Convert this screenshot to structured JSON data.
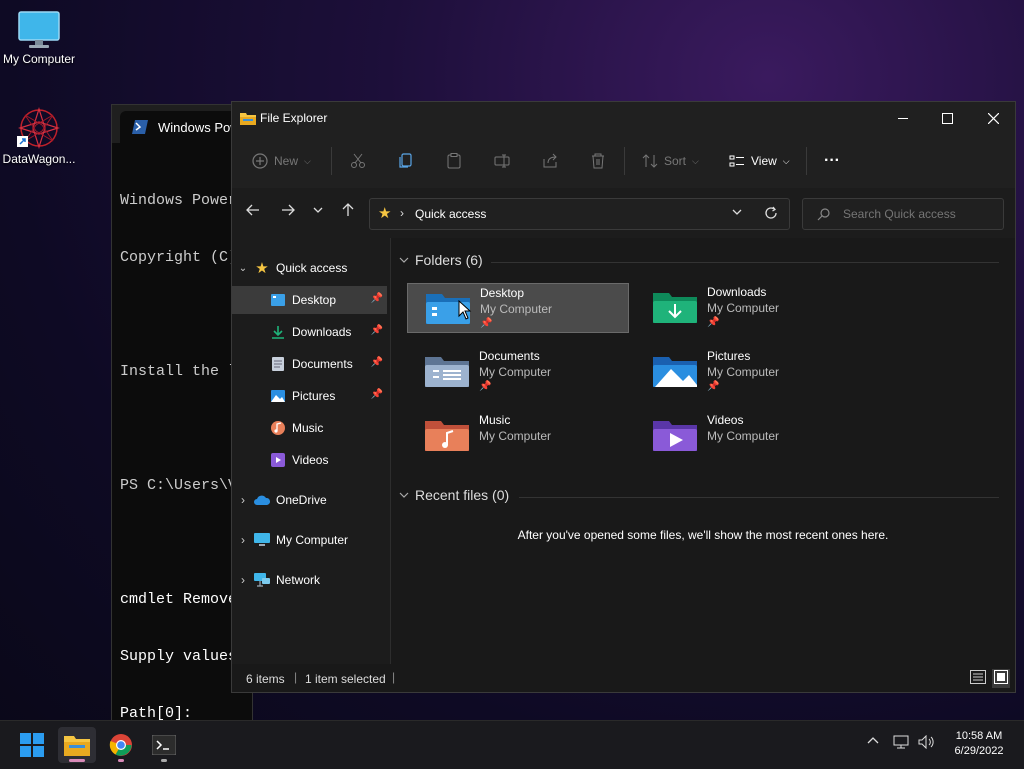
{
  "desktop": {
    "icons": [
      {
        "label": "My Computer"
      },
      {
        "label": "DataWagon..."
      }
    ]
  },
  "powershell": {
    "tab_title": "Windows Powe",
    "lines": [
      "Windows Power",
      "Copyright (C)",
      "",
      "Install the l",
      "",
      "PS C:\\Users\\V",
      "",
      "cmdlet Remove",
      "Supply values",
      "Path[0]:"
    ]
  },
  "explorer": {
    "title": "File Explorer",
    "toolbar": {
      "new_label": "New",
      "sort_label": "Sort",
      "view_label": "View",
      "more_label": "···"
    },
    "address": {
      "location": "Quick access"
    },
    "search": {
      "placeholder": "Search Quick access"
    },
    "sidebar": {
      "quick_access": "Quick access",
      "pinned": [
        {
          "label": "Desktop"
        },
        {
          "label": "Downloads"
        },
        {
          "label": "Documents"
        },
        {
          "label": "Pictures"
        },
        {
          "label": "Music"
        },
        {
          "label": "Videos"
        }
      ],
      "onedrive": "OneDrive",
      "my_computer": "My Computer",
      "network": "Network"
    },
    "main": {
      "folders_header": "Folders (6)",
      "folders": [
        {
          "name": "Desktop",
          "location": "My Computer",
          "pinned": true,
          "selected": true,
          "color": "#3aa0e8"
        },
        {
          "name": "Downloads",
          "location": "My Computer",
          "pinned": true,
          "selected": false,
          "color": "#1fb37a"
        },
        {
          "name": "Documents",
          "location": "My Computer",
          "pinned": true,
          "selected": false,
          "color": "#8aa4c8"
        },
        {
          "name": "Pictures",
          "location": "My Computer",
          "pinned": true,
          "selected": false,
          "color": "#2a8ee0"
        },
        {
          "name": "Music",
          "location": "My Computer",
          "pinned": false,
          "selected": false,
          "color": "#e8805a"
        },
        {
          "name": "Videos",
          "location": "My Computer",
          "pinned": false,
          "selected": false,
          "color": "#8a5ad8"
        }
      ],
      "recent_header": "Recent files (0)",
      "recent_empty": "After you've opened some files, we'll show the most recent ones here."
    },
    "status": {
      "items": "6 items",
      "selected": "1 item selected"
    }
  },
  "taskbar": {
    "clock_time": "10:58 AM",
    "clock_date": "6/29/2022"
  },
  "colors": {
    "accent": "#0078d4",
    "folder_yellow": "#f5c542"
  }
}
